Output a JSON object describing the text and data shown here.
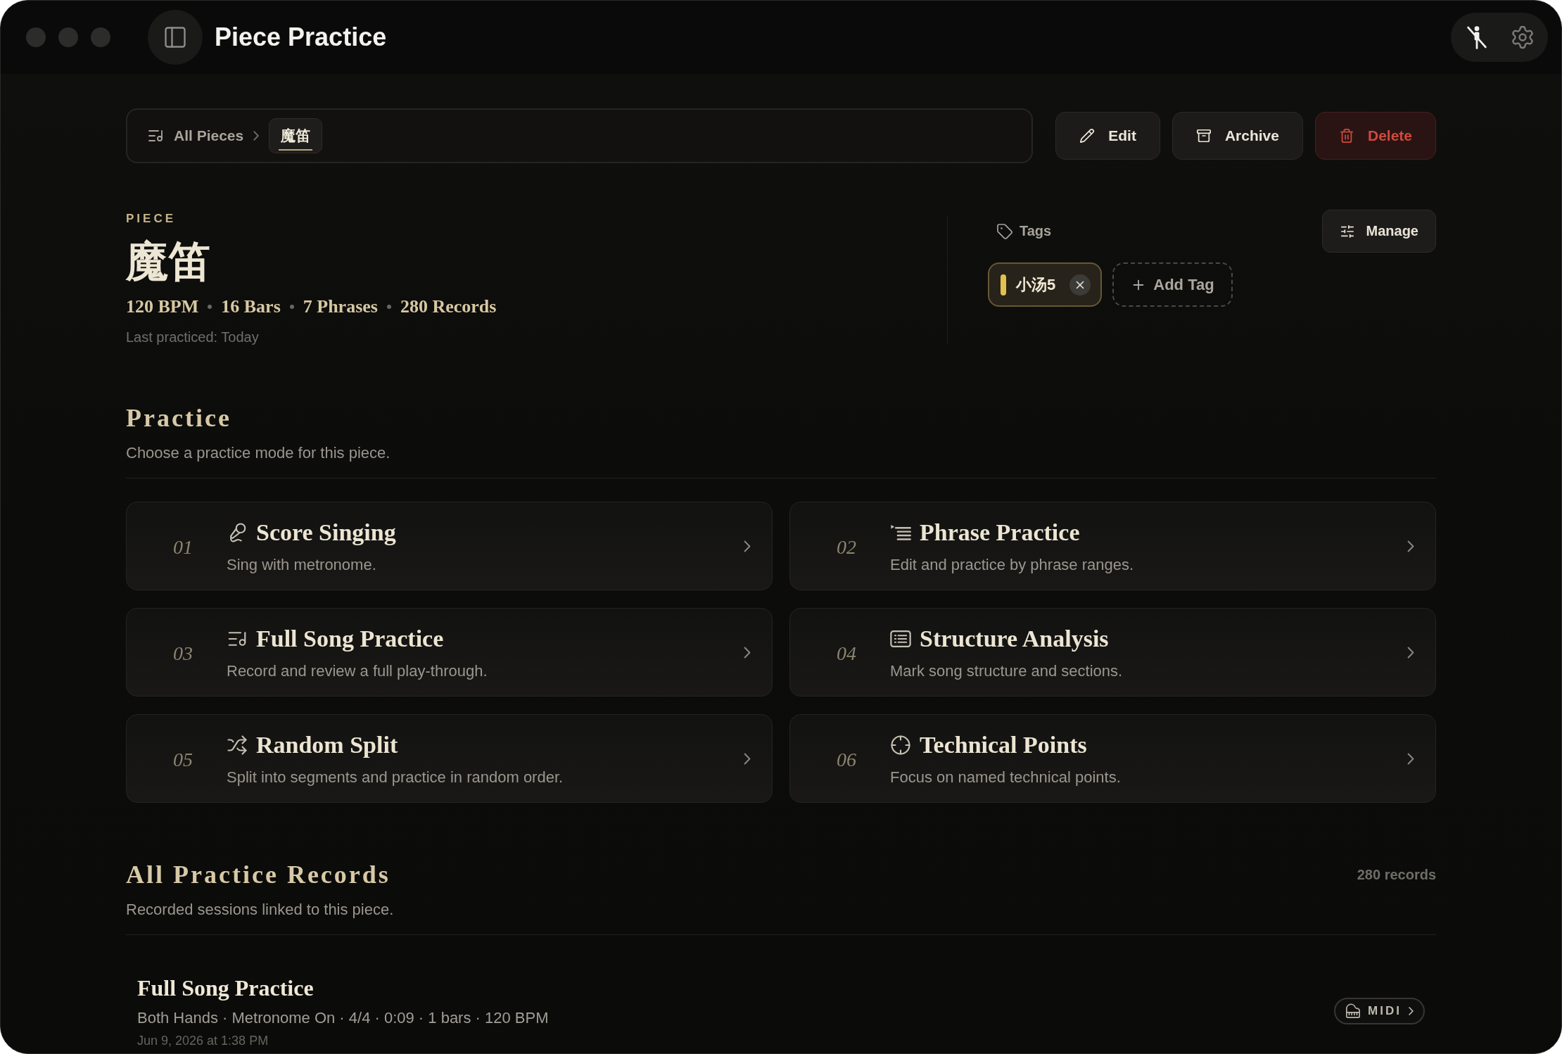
{
  "window": {
    "title": "Piece Practice"
  },
  "breadcrumb": [
    {
      "label": "All Pieces",
      "selected": false
    },
    {
      "label": "魔笛",
      "selected": true
    }
  ],
  "actions": [
    {
      "kind": "edit",
      "label": "Edit"
    },
    {
      "kind": "archive",
      "label": "Archive"
    },
    {
      "kind": "delete",
      "label": "Delete"
    }
  ],
  "piece": {
    "eyebrow": "PIECE",
    "title": "魔笛",
    "stats": [
      "120 BPM",
      "16 Bars",
      "7 Phrases",
      "280 Records"
    ],
    "last_practiced": "Last practiced: Today"
  },
  "tags": {
    "label": "Tags",
    "manage": "Manage",
    "items": [
      {
        "label": "小汤5",
        "color": "#e2c04f"
      }
    ],
    "add": "Add Tag"
  },
  "practice": {
    "title": "Practice",
    "subtitle": "Choose a practice mode for this piece.",
    "modes": [
      {
        "number": "01",
        "kind": "singing",
        "title": "Score Singing",
        "description": "Sing with metronome."
      },
      {
        "number": "02",
        "kind": "phrases",
        "title": "Phrase Practice",
        "description": "Edit and practice by phrase ranges."
      },
      {
        "number": "03",
        "kind": "full_song",
        "title": "Full Song Practice",
        "description": "Record and review a full play-through."
      },
      {
        "number": "04",
        "kind": "structure",
        "title": "Structure Analysis",
        "description": "Mark song structure and sections."
      },
      {
        "number": "05",
        "kind": "random",
        "title": "Random Split",
        "description": "Split into segments and practice in random order."
      },
      {
        "number": "06",
        "kind": "technical",
        "title": "Technical Points",
        "description": "Focus on named technical points."
      }
    ]
  },
  "records": {
    "title": "All Practice Records",
    "count": "280 records",
    "subtitle": "Recorded sessions linked to this piece.",
    "items": [
      {
        "title": "Full Song Practice",
        "meta": "Both Hands · Metronome On · 4/4 · 0:09 · 1 bars · 120 BPM",
        "date": "Jun 9, 2026 at 1:38 PM",
        "badge": "MIDI"
      }
    ]
  }
}
